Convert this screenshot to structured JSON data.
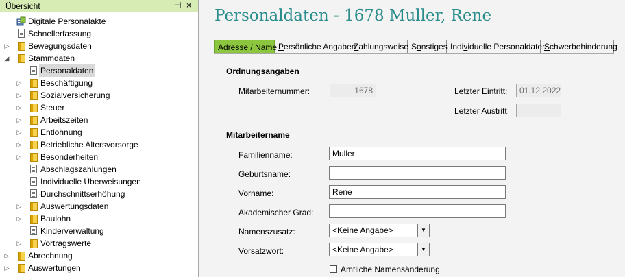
{
  "panel": {
    "title": "Übersicht",
    "pin_glyph": "⊣",
    "close_glyph": "×"
  },
  "tree": [
    {
      "label": "Digitale Personalakte",
      "icon": "file-cabinet-icon",
      "level": 1,
      "expander": ""
    },
    {
      "label": "Schnellerfassung",
      "icon": "doc-icon",
      "level": 1,
      "expander": ""
    },
    {
      "label": "Bewegungsdaten",
      "icon": "folder-icon",
      "level": 1,
      "expander": "collapsed"
    },
    {
      "label": "Stammdaten",
      "icon": "folder-icon",
      "level": 1,
      "expander": "expanded"
    },
    {
      "label": "Personaldaten",
      "icon": "doc-icon",
      "level": 2,
      "expander": "",
      "selected": true
    },
    {
      "label": "Beschäftigung",
      "icon": "folder-icon",
      "level": 2,
      "expander": "collapsed"
    },
    {
      "label": "Sozialversicherung",
      "icon": "folder-icon",
      "level": 2,
      "expander": "collapsed"
    },
    {
      "label": "Steuer",
      "icon": "folder-icon",
      "level": 2,
      "expander": "collapsed"
    },
    {
      "label": "Arbeitszeiten",
      "icon": "folder-icon",
      "level": 2,
      "expander": "collapsed"
    },
    {
      "label": "Entlohnung",
      "icon": "folder-icon",
      "level": 2,
      "expander": "collapsed"
    },
    {
      "label": "Betriebliche Altersvorsorge",
      "icon": "folder-icon",
      "level": 2,
      "expander": "collapsed"
    },
    {
      "label": "Besonderheiten",
      "icon": "folder-icon",
      "level": 2,
      "expander": "collapsed"
    },
    {
      "label": "Abschlagszahlungen",
      "icon": "doc-icon",
      "level": 2,
      "expander": ""
    },
    {
      "label": "Individuelle Überweisungen",
      "icon": "doc-icon",
      "level": 2,
      "expander": ""
    },
    {
      "label": "Durchschnittserhöhung",
      "icon": "doc-icon",
      "level": 2,
      "expander": ""
    },
    {
      "label": "Auswertungsdaten",
      "icon": "folder-icon",
      "level": 2,
      "expander": "collapsed"
    },
    {
      "label": "Baulohn",
      "icon": "folder-icon",
      "level": 2,
      "expander": "collapsed"
    },
    {
      "label": "Kinderverwaltung",
      "icon": "doc-icon",
      "level": 2,
      "expander": ""
    },
    {
      "label": "Vortragswerte",
      "icon": "folder-icon",
      "level": 2,
      "expander": "collapsed"
    },
    {
      "label": "Abrechnung",
      "icon": "folder-icon",
      "level": 1,
      "expander": "collapsed"
    },
    {
      "label": "Auswertungen",
      "icon": "folder-icon",
      "level": 1,
      "expander": "collapsed"
    }
  ],
  "expander_glyphs": {
    "collapsed": "▷",
    "expanded": "◢"
  },
  "main": {
    "title": "Personaldaten - 1678 Muller, Rene",
    "tabs": [
      {
        "label": "Adresse / Name",
        "active": true
      },
      {
        "label": "Persönliche Angaben",
        "active": false
      },
      {
        "label": "Zahlungsweise",
        "active": false
      },
      {
        "label": "Sonstiges",
        "active": false
      },
      {
        "label": "Individuelle Personaldaten",
        "active": false
      },
      {
        "label": "Schwerbehinderung",
        "active": false
      }
    ],
    "ordnung": {
      "heading": "Ordnungsangaben",
      "mitarbeiternummer_label": "Mitarbeiternummer:",
      "mitarbeiternummer_value": "1678",
      "eintritt_label": "Letzter Eintritt:",
      "eintritt_value": "01.12.2022",
      "austritt_label": "Letzter Austritt:",
      "austritt_value": ""
    },
    "name": {
      "heading": "Mitarbeitername",
      "familienname_label": "Familienname:",
      "familienname_value": "Muller",
      "geburtsname_label": "Geburtsname:",
      "geburtsname_value": "",
      "vorname_label": "Vorname:",
      "vorname_value": "Rene",
      "grad_label": "Akademischer Grad:",
      "grad_value": "",
      "namenszusatz_label": "Namenszusatz:",
      "namenszusatz_value": "<Keine Angabe>",
      "vorsatzwort_label": "Vorsatzwort:",
      "vorsatzwort_value": "<Keine Angabe>",
      "amtlich_label": "Amtliche Namensänderung",
      "amtlich_checked": false
    }
  },
  "colors": {
    "accent": "#8cc63f",
    "title": "#2b8c8c",
    "panel_header": "#d7ecb4"
  }
}
